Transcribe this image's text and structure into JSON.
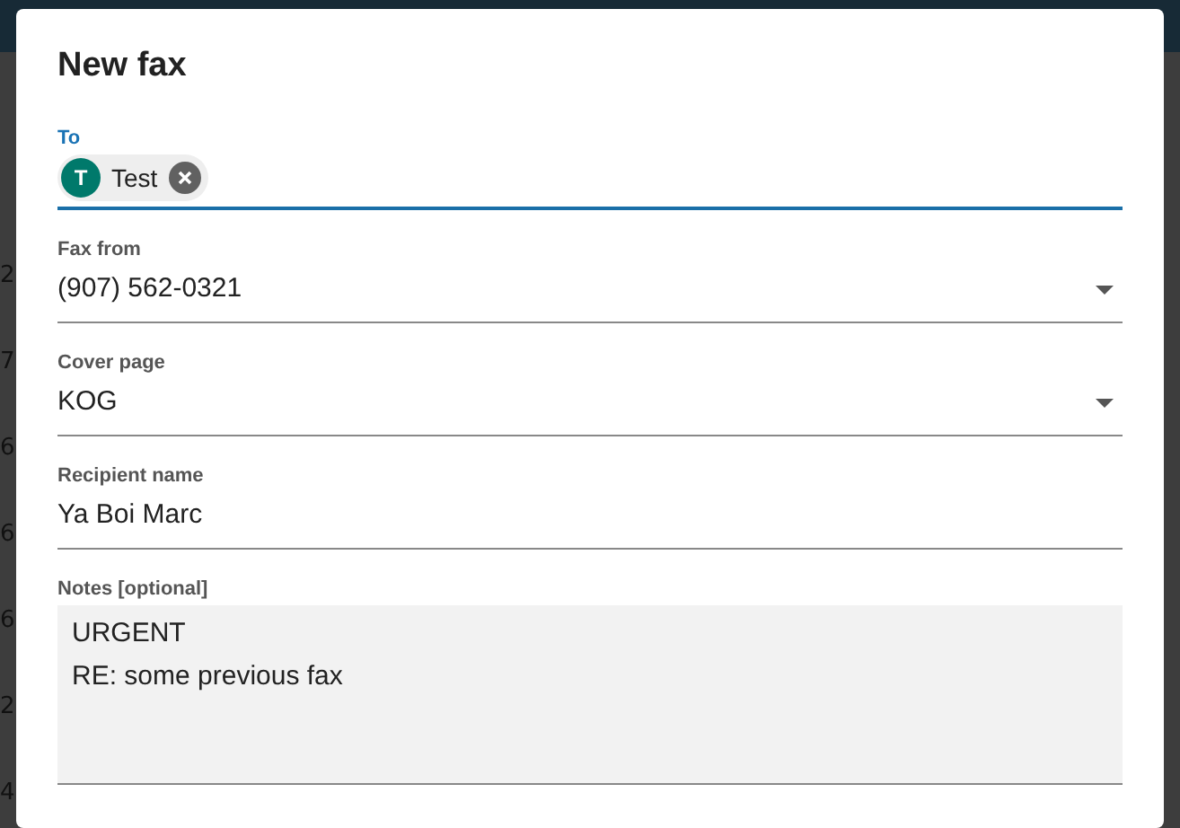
{
  "background": {
    "row_digits": [
      "2",
      "7",
      "6",
      "6",
      "6",
      "2",
      "4"
    ]
  },
  "dialog": {
    "title": "New fax",
    "fields": [
      {
        "kind": "chips",
        "label": "To",
        "focused": true,
        "chips": [
          {
            "initial": "T",
            "name": "Test",
            "color": "#00796b"
          }
        ]
      },
      {
        "kind": "select",
        "label": "Fax from",
        "focused": false,
        "value": "(907) 562-0321"
      },
      {
        "kind": "select",
        "label": "Cover page",
        "focused": false,
        "value": "KOG"
      },
      {
        "kind": "text",
        "label": "Recipient name",
        "focused": false,
        "value": "Ya Boi Marc"
      },
      {
        "kind": "textarea",
        "label": "Notes [optional]",
        "focused": false,
        "value": "URGENT\nRE: some previous fax"
      }
    ]
  }
}
